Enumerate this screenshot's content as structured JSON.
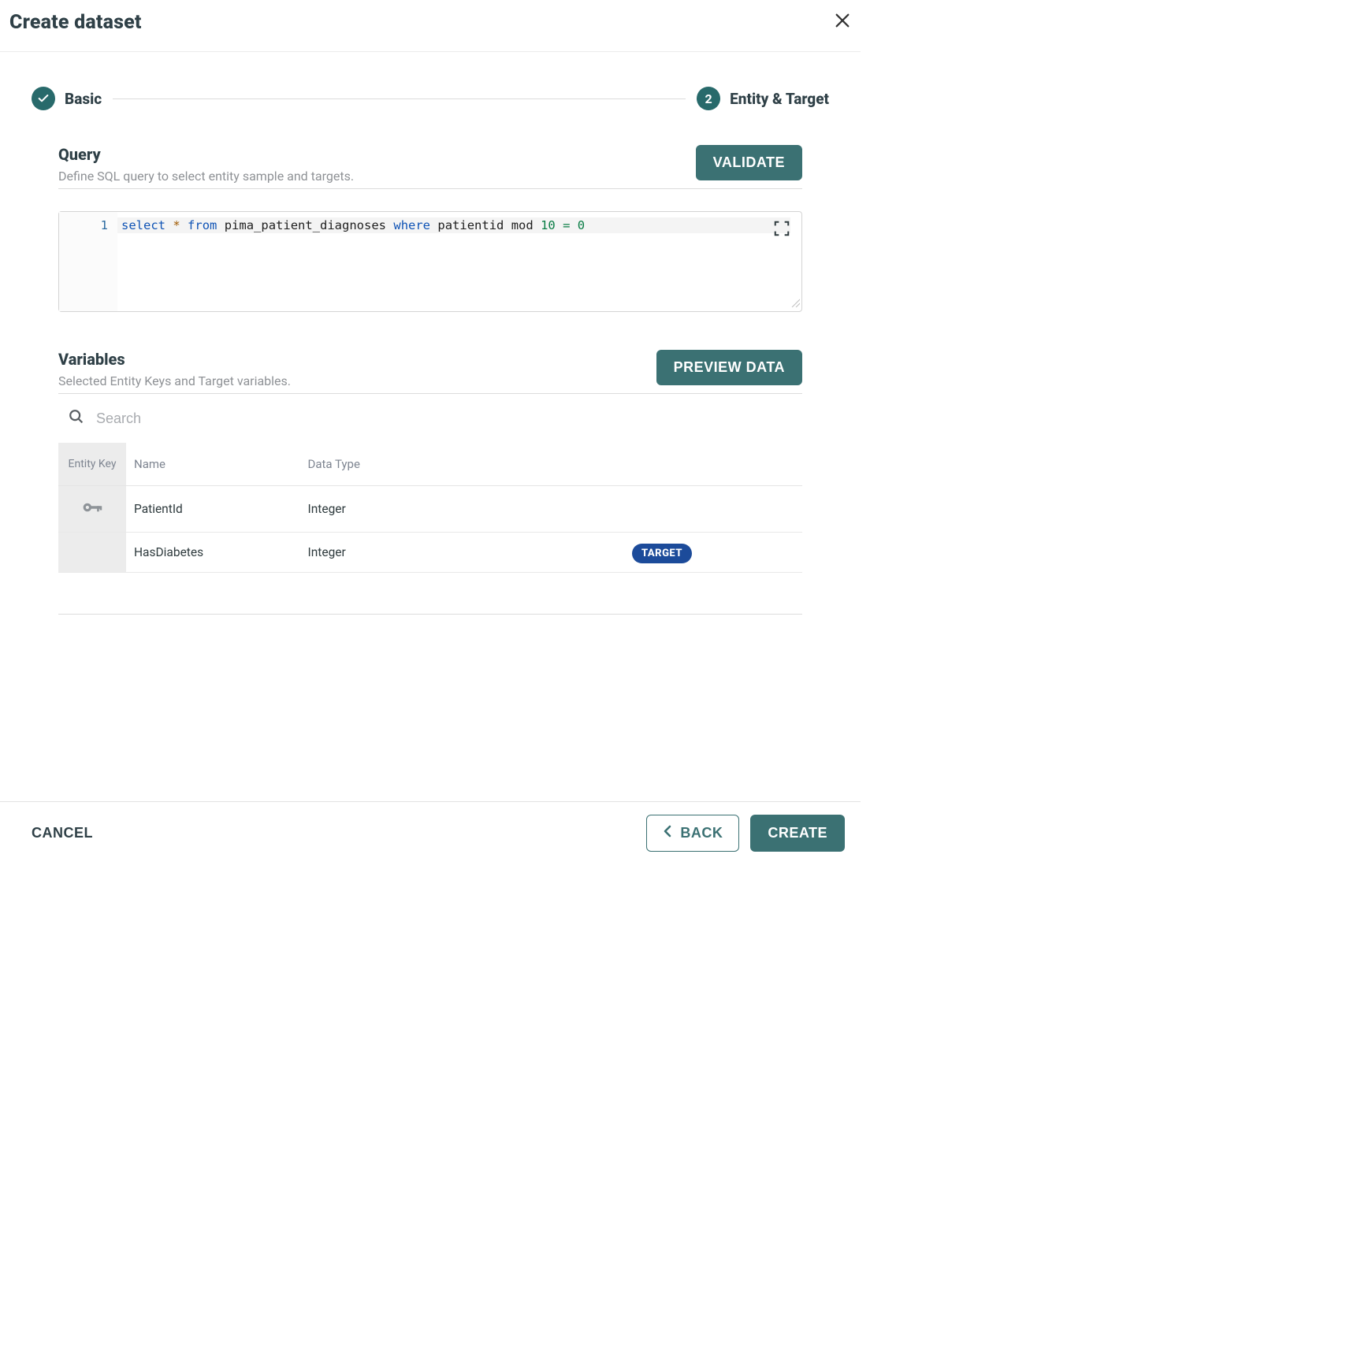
{
  "header": {
    "title": "Create dataset"
  },
  "stepper": {
    "step1_label": "Basic",
    "step2_num": "2",
    "step2_label": "Entity & Target"
  },
  "query_section": {
    "title": "Query",
    "subtitle": "Define SQL query to select entity sample and targets.",
    "validate_label": "Validate"
  },
  "editor": {
    "line_number": "1",
    "sql_tokens": {
      "t1": "select",
      "t2": "*",
      "t3": "from",
      "t4": "pima_patient_diagnoses",
      "t5": "where",
      "t6": "patientid",
      "t7": "mod",
      "t8": "10",
      "t9": "=",
      "t10": "0"
    }
  },
  "variables_section": {
    "title": "Variables",
    "subtitle": "Selected Entity Keys and Target variables.",
    "preview_label": "Preview data",
    "search_placeholder": "Search"
  },
  "table": {
    "headers": {
      "entity_key": "Entity Key",
      "name": "Name",
      "data_type": "Data Type"
    },
    "rows": [
      {
        "is_key": true,
        "name": "PatientId",
        "data_type": "Integer",
        "badge": ""
      },
      {
        "is_key": false,
        "name": "HasDiabetes",
        "data_type": "Integer",
        "badge": "TARGET"
      }
    ]
  },
  "footer": {
    "cancel": "Cancel",
    "back": "Back",
    "create": "Create"
  }
}
